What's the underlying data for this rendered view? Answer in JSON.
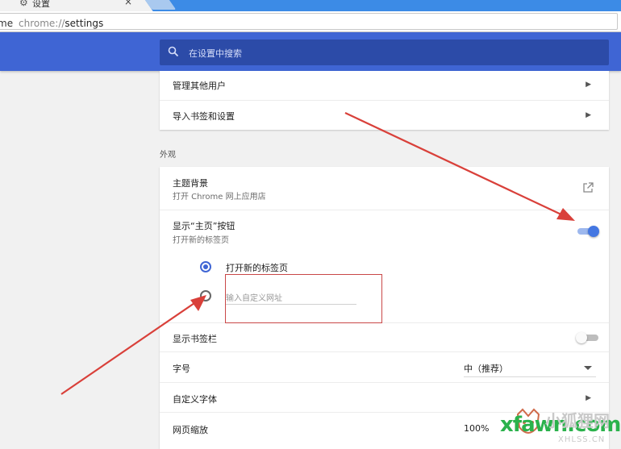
{
  "browser": {
    "tab_title": "设置",
    "url_prefix": "me",
    "url_scheme": "chrome://",
    "url_path": "settings"
  },
  "header": {
    "search_placeholder": "在设置中搜索"
  },
  "people": {
    "items": [
      {
        "label": "管理其他用户"
      },
      {
        "label": "导入书签和设置"
      }
    ]
  },
  "appearance": {
    "section_title": "外观",
    "theme": {
      "label": "主题背景",
      "sub": "打开 Chrome 网上应用店"
    },
    "home_button": {
      "label": "显示“主页”按钮",
      "sub": "打开新的标签页",
      "enabled": true
    },
    "home_options": {
      "new_tab": "打开新的标签页",
      "custom_placeholder": "输入自定义网址",
      "selected": "new_tab"
    },
    "bookmarks_bar": {
      "label": "显示书签栏",
      "enabled": false
    },
    "font_size": {
      "label": "字号",
      "value": "中（推荐）"
    },
    "custom_fonts": {
      "label": "自定义字体"
    },
    "zoom": {
      "label": "网页缩放",
      "value": "100%"
    }
  },
  "watermark": {
    "site": "xfawn.com",
    "cn": "小狐狸网",
    "en": "XHLSS.CN"
  },
  "colors": {
    "accent": "#3f65d4",
    "annotation": "#d9403a"
  }
}
